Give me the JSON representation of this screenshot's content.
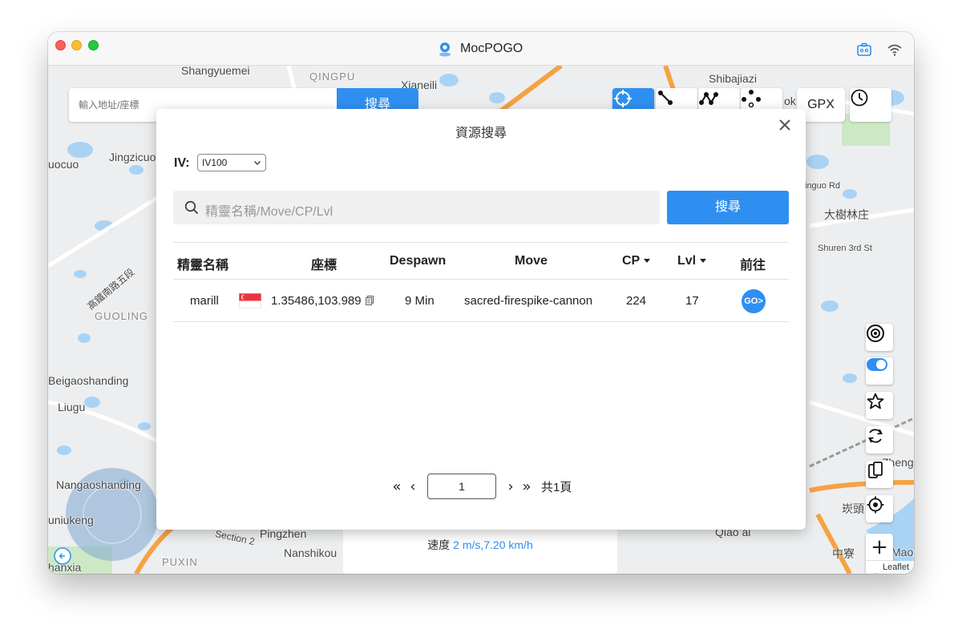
{
  "window": {
    "title": "MocPOGO"
  },
  "map": {
    "address_placeholder": "輸入地址/座標",
    "address_search_label": "搜尋",
    "gpx_label": "GPX",
    "speed_label": "速度",
    "speed_value": "2 m/s,7.20 km/h",
    "attribution": "Leaflet",
    "zoom_in": "+",
    "zoom_out": "−",
    "labels": [
      "Shangyuemei",
      "QINGPU",
      "Xianeili",
      "Shibajiazi",
      "Jingzicuo",
      "uocuo",
      "inguo Rd",
      "大樹林庄",
      "Shuren 3rd St",
      "GUOLING",
      "Beigaoshanding",
      "Liugu",
      "Nangaoshanding",
      "uniukeng",
      "Pingzhen",
      "Nanshikou",
      "PUXIN",
      "hanxia",
      "Qiao ai",
      "崁頭",
      "中寮",
      "Maop",
      "Zheng",
      "ok",
      "Section 2",
      "高鐵南路五段"
    ]
  },
  "modal": {
    "title": "資源搜尋",
    "iv_label": "IV:",
    "iv_value": "IV100",
    "search_placeholder": "精靈名稱/Move/CP/Lvl",
    "search_button": "搜尋",
    "columns": [
      "精靈名稱",
      "座標",
      "Despawn",
      "Move",
      "CP",
      "Lvl",
      "前往"
    ],
    "rows": [
      {
        "name": "marill",
        "coords": "1.35486,103.989",
        "despawn": "9 Min",
        "move": "sacred-firespike-cannon",
        "cp": "224",
        "lvl": "17",
        "go": "GO>"
      }
    ],
    "pagination": {
      "current_page": "1",
      "total": "共1頁"
    }
  },
  "colors": {
    "accent": "#2f8ff0",
    "road_orange": "#f5a243",
    "water": "#a9d3f5",
    "park": "#cde8c4"
  }
}
